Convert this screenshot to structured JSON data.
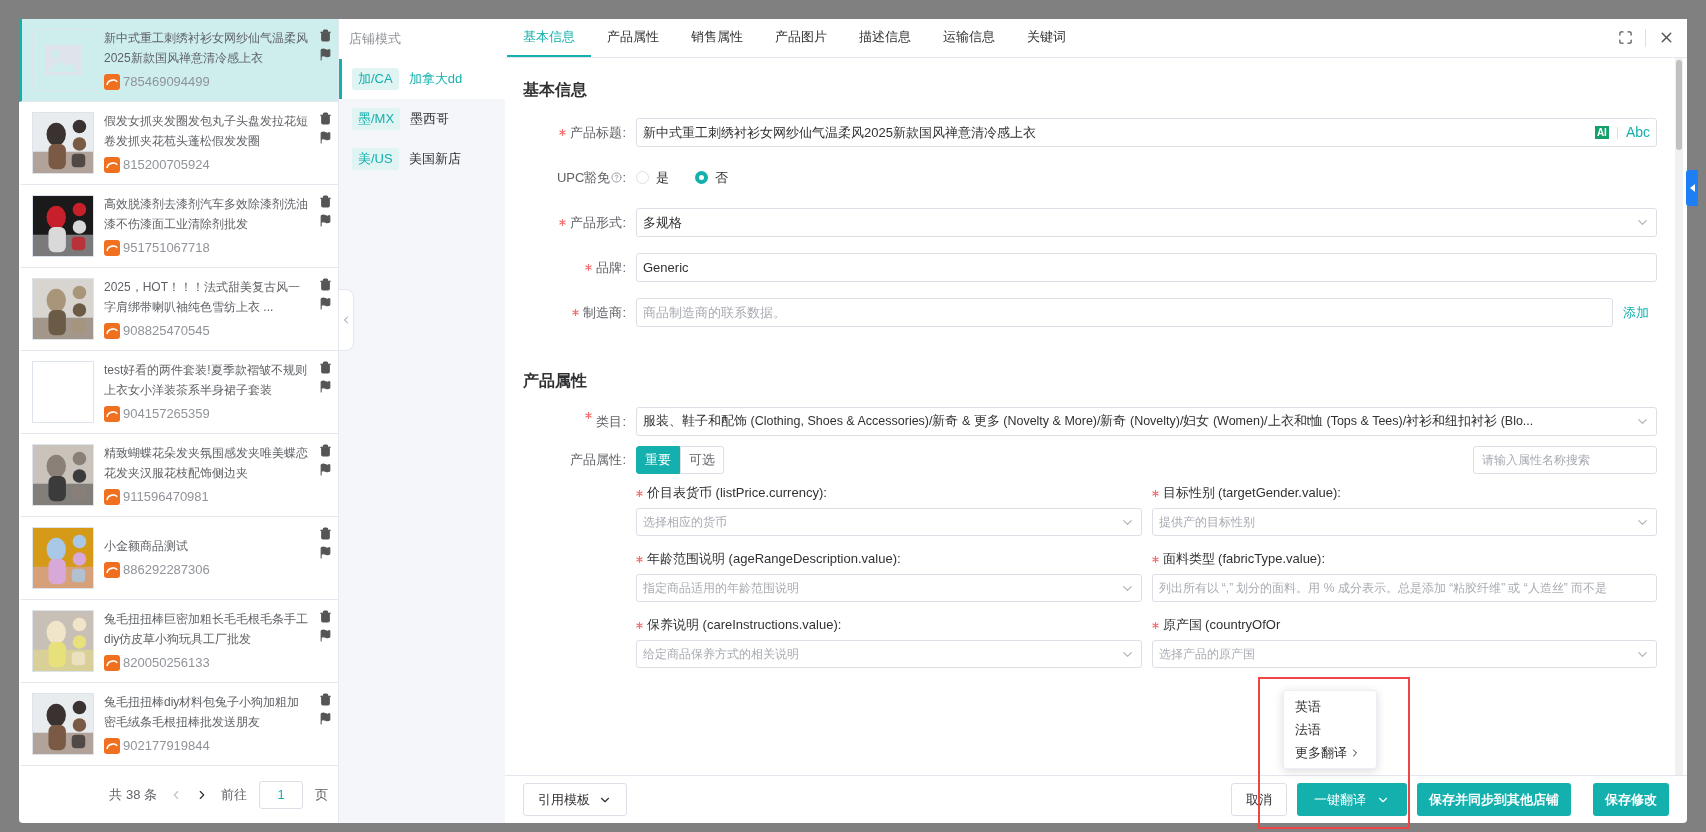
{
  "products": [
    {
      "title": "新中式重工刺绣衬衫女网纱仙气温柔风2025新款国风禅意清冷感上衣",
      "id": "785469094499",
      "selected": true,
      "kind": "placeholder"
    },
    {
      "title": "假发女抓夹发圈发包丸子头盘发拉花短卷发抓夹花苞头蓬松假发发圈",
      "id": "815200705924",
      "selected": false,
      "kind": "picture"
    },
    {
      "title": "高效脱漆剂去漆剂汽车多效除漆剂洗油漆不伤漆面工业清除剂批发",
      "id": "951751067718",
      "selected": false,
      "kind": "picture"
    },
    {
      "title": "2025，HOT！！！法式甜美复古风一字肩绑带喇叭袖纯色雪纺上衣 ...",
      "id": "908825470545",
      "selected": false,
      "kind": "picture"
    },
    {
      "title": "test好看的两件套装!夏季款褶皱不规则上衣女小洋装茶系半身裙子套装",
      "id": "904157265359",
      "selected": false,
      "kind": "blank"
    },
    {
      "title": "精致蝴蝶花朵发夹氛围感发夹唯美蝶恋花发夹汉服花枝配饰侧边夹",
      "id": "911596470981",
      "selected": false,
      "kind": "picture"
    },
    {
      "title": "小金额商品测试",
      "id": "886292287306",
      "selected": false,
      "kind": "picture"
    },
    {
      "title": "兔毛扭扭棒巨密加粗长毛毛根毛条手工diy仿皮草小狗玩具工厂批发",
      "id": "820050256133",
      "selected": false,
      "kind": "picture"
    },
    {
      "title": "兔毛扭扭棒diy材料包兔子小狗加粗加密毛绒条毛根扭棒批发送朋友",
      "id": "902177919844",
      "selected": false,
      "kind": "picture"
    }
  ],
  "pagination": {
    "total": "共 38 条",
    "goto": "前往",
    "page": "1",
    "unit": "页"
  },
  "stores": {
    "title": "店铺模式",
    "items": [
      {
        "tag": "加/CA",
        "name": "加拿大dd",
        "selected": true
      },
      {
        "tag": "墨/MX",
        "name": "墨西哥",
        "selected": false
      },
      {
        "tag": "美/US",
        "name": "美国新店",
        "selected": false
      }
    ]
  },
  "tabs": [
    {
      "label": "基本信息",
      "selected": true
    },
    {
      "label": "产品属性",
      "selected": false
    },
    {
      "label": "销售属性",
      "selected": false
    },
    {
      "label": "产品图片",
      "selected": false
    },
    {
      "label": "描述信息",
      "selected": false
    },
    {
      "label": "运输信息",
      "selected": false
    },
    {
      "label": "关键词",
      "selected": false
    }
  ],
  "basic": {
    "heading": "基本信息",
    "fields": [
      {
        "kind": "text",
        "label": "产品标题:",
        "required": true,
        "value": "新中式重工刺绣衬衫女网纱仙气温柔风2025新款国风禅意清冷感上衣",
        "ai": "AI",
        "abc": "Abc"
      },
      {
        "kind": "radio",
        "label": "UPC豁免",
        "suffix": ":",
        "required": false,
        "options": [
          {
            "label": "是",
            "selected": false
          },
          {
            "label": "否",
            "selected": true
          }
        ]
      },
      {
        "kind": "select",
        "label": "产品形式:",
        "required": true,
        "value": "多规格"
      },
      {
        "kind": "text",
        "label": "品牌:",
        "required": true,
        "value": "Generic"
      },
      {
        "kind": "add",
        "label": "制造商:",
        "required": true,
        "placeholder": "商品制造商的联系数据。",
        "action": "添加"
      }
    ]
  },
  "attributes": {
    "heading": "产品属性",
    "category_label": "类目:",
    "category_required": true,
    "category": "服装、鞋子和配饰 (Clothing, Shoes & Accessories)/新奇 & 更多 (Novelty & More)/新奇 (Novelty)/妇女 (Women)/上衣和t恤 (Tops & Tees)/衬衫和纽扣衬衫 (Blo...",
    "attr_label": "产品属性:",
    "toggle": [
      {
        "label": "重要",
        "selected": true
      },
      {
        "label": "可选",
        "selected": false
      }
    ],
    "search_placeholder": "请输入属性名称搜索",
    "items": [
      {
        "label": "价目表货币 (listPrice.currency):",
        "placeholder": "选择相应的货币",
        "kind": "select",
        "required": true
      },
      {
        "label": "目标性别 (targetGender.value):",
        "placeholder": "提供产的目标性别",
        "kind": "select",
        "required": true
      },
      {
        "label": "年龄范围说明 (ageRangeDescription.value):",
        "placeholder": "指定商品适用的年龄范围说明",
        "kind": "select",
        "required": true
      },
      {
        "label": "面料类型 (fabricType.value):",
        "placeholder": "列出所有以 “,” 划分的面料。用 % 成分表示。总是添加 “粘胶纤维” 或 “人造丝” 而不是",
        "kind": "input",
        "required": true
      },
      {
        "label": "保养说明 (careInstructions.value):",
        "placeholder": "给定商品保养方式的相关说明",
        "kind": "select",
        "required": true
      },
      {
        "label": "原产国 (countryOfOr",
        "placeholder": "选择产品的原产国",
        "kind": "select",
        "required": true
      }
    ]
  },
  "footer": {
    "template": "引用模板",
    "cancel": "取消",
    "translate": "一键翻译",
    "save_sync": "保存并同步到其他店铺",
    "save": "保存修改"
  },
  "translate_menu": [
    "英语",
    "法语",
    "更多翻译"
  ]
}
